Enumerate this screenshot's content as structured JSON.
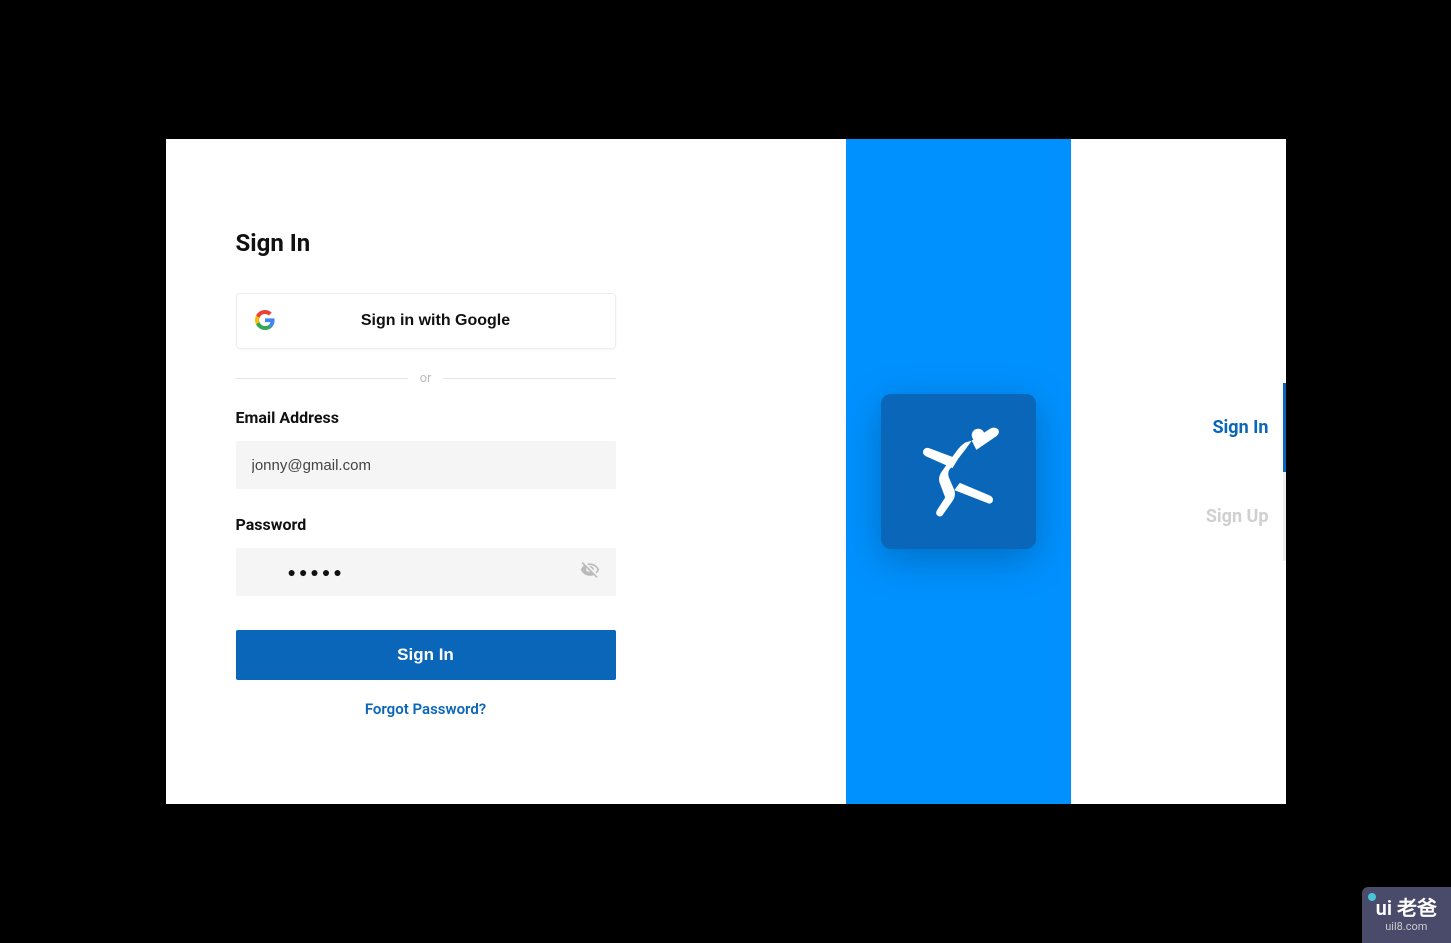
{
  "form": {
    "title": "Sign In",
    "google_label": "Sign in with Google",
    "divider_text": "or",
    "email_label": "Email Address",
    "email_value": "jonny@gmail.com",
    "password_label": "Password",
    "password_mask": "●●●●●",
    "submit_label": "Sign In",
    "forgot_label": "Forgot Password?"
  },
  "nav": {
    "sign_in": "Sign In",
    "sign_up": "Sign Up"
  },
  "watermark": {
    "main": "ui 老爸",
    "sub": "uil8.com"
  }
}
